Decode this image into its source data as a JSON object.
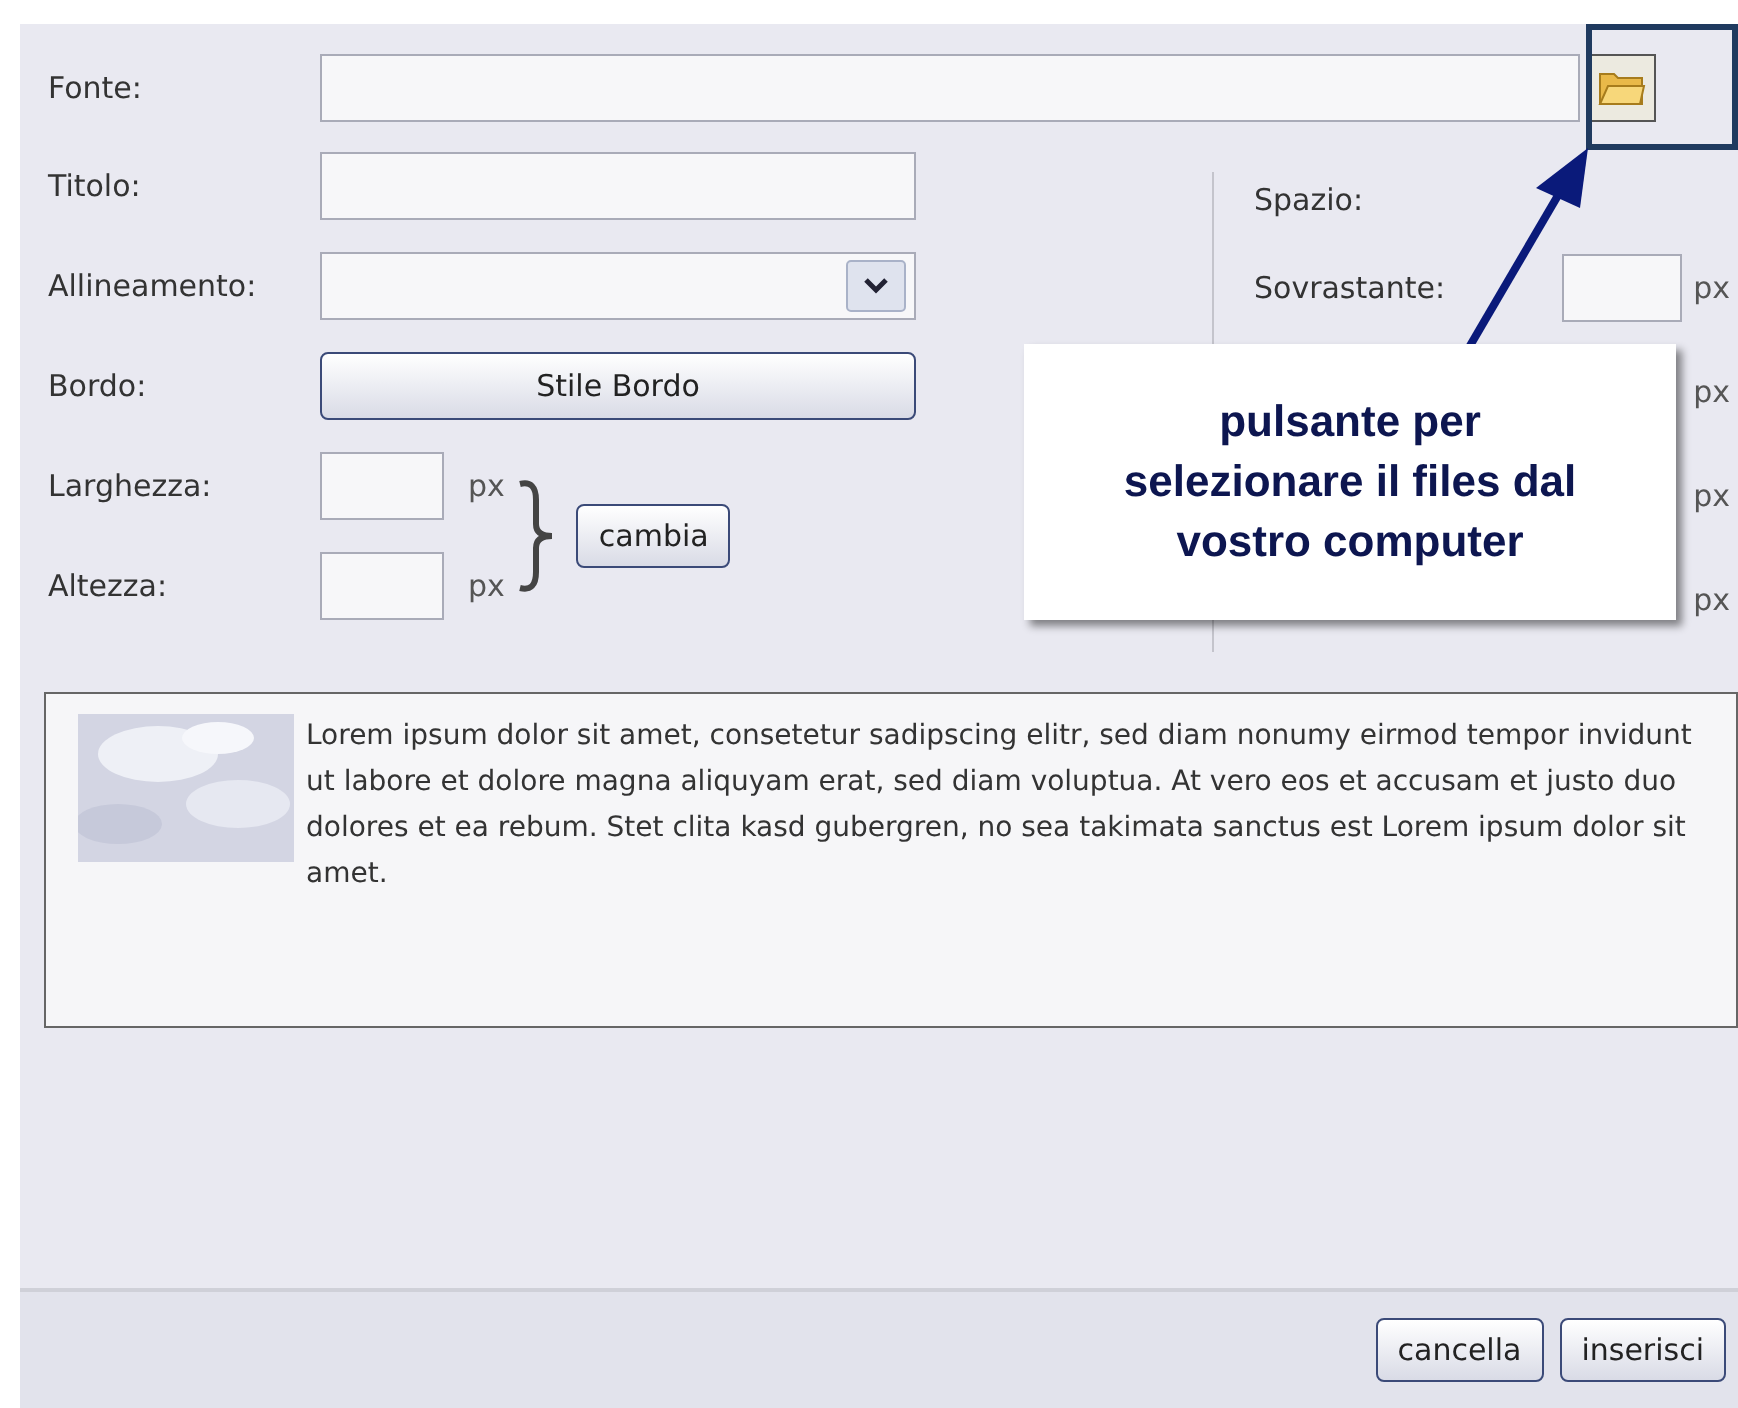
{
  "form": {
    "fields": [
      {
        "kind": "file",
        "label": "Fonte:"
      },
      {
        "kind": "text",
        "label": "Titolo:"
      },
      {
        "kind": "select",
        "label": "Allineamento:"
      },
      {
        "kind": "button",
        "label": "Bordo:",
        "button": "Stile Bordo"
      }
    ],
    "size": {
      "rows": [
        {
          "label": "Larghezza:",
          "unit": "px"
        },
        {
          "label": "Altezza:",
          "unit": "px"
        }
      ],
      "button": "cambia"
    }
  },
  "spacing": {
    "title": "Spazio:",
    "rows": [
      {
        "label": "Sovrastante:",
        "unit": "px"
      },
      {
        "unit": "px"
      },
      {
        "unit": "px"
      },
      {
        "unit": "px"
      }
    ]
  },
  "callout": {
    "lines": [
      "pulsante per",
      "selezionare il files dal",
      "vostro computer"
    ]
  },
  "preview": {
    "text": "Lorem ipsum dolor sit amet, consetetur sadipscing elitr, sed diam nonumy eirmod tempor invidunt ut labore et dolore magna aliquyam erat, sed diam voluptua. At vero eos et accusam et justo duo dolores et ea rebum. Stet clita kasd gubergren, no sea takimata sanctus est Lorem ipsum dolor sit amet."
  },
  "buttons": [
    "cancella",
    "inserisci"
  ]
}
